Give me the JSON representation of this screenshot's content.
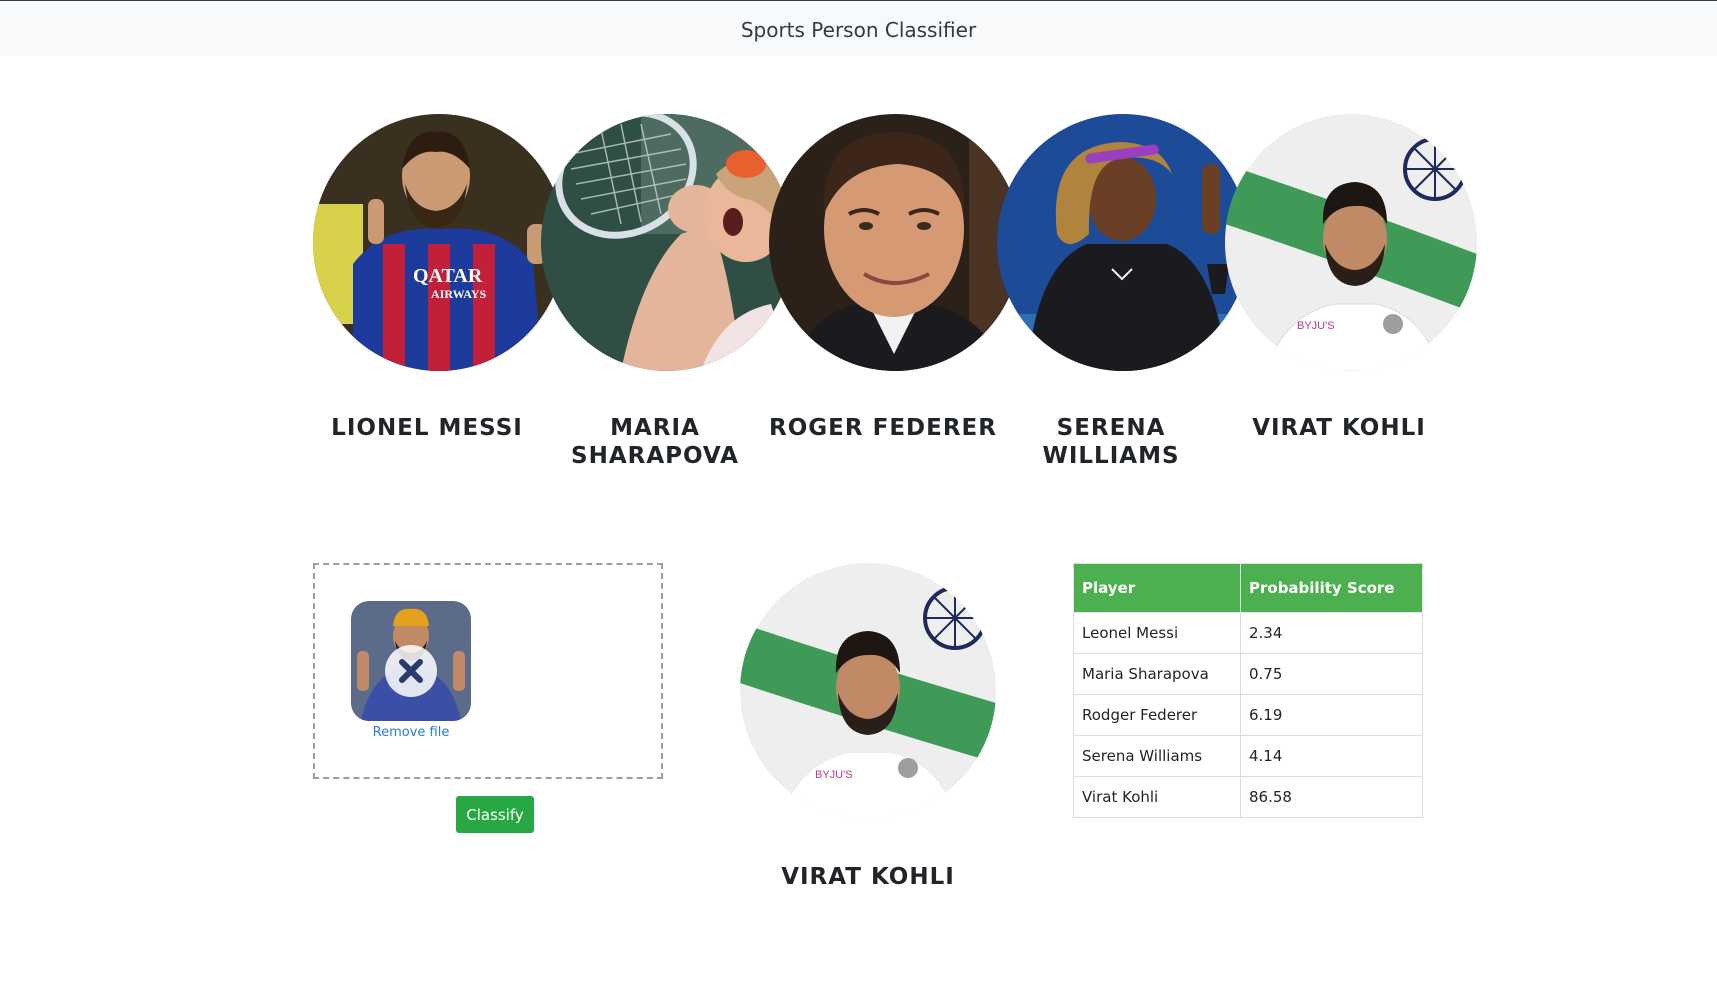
{
  "navbar": {
    "title": "Sports Person Classifier"
  },
  "players": [
    {
      "name": "LIONEL MESSI"
    },
    {
      "name": "MARIA SHARAPOVA"
    },
    {
      "name": "ROGER FEDERER"
    },
    {
      "name": "SERENA WILLIAMS"
    },
    {
      "name": "VIRAT KOHLI"
    }
  ],
  "upload": {
    "remove_label": "Remove file",
    "classify_label": "Classify"
  },
  "result": {
    "name": "VIRAT KOHLI"
  },
  "table": {
    "headers": [
      "Player",
      "Probability Score"
    ],
    "rows": [
      [
        "Leonel Messi",
        "2.34"
      ],
      [
        "Maria Sharapova",
        "0.75"
      ],
      [
        "Rodger Federer",
        "6.19"
      ],
      [
        "Serena Williams",
        "4.14"
      ],
      [
        "Virat Kohli",
        "86.58"
      ]
    ]
  }
}
